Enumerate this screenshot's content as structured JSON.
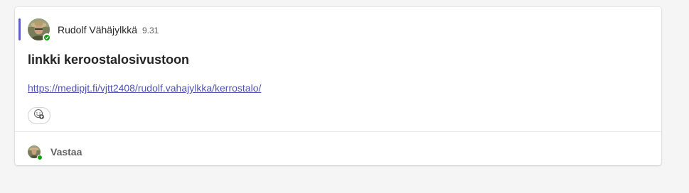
{
  "message": {
    "author": "Rudolf Vähäjylkkä",
    "timestamp": "9.31",
    "subject": "linkki keroostalosivustoon",
    "link": "https://medipjt.fi/vjtt2408/rudolf.vahajylkka/kerrostalo/",
    "reaction_icon": "add-reaction-icon",
    "presence": "available",
    "accent_color": "#5b5fc7",
    "link_color": "#4f52b2",
    "presence_color": "#13a10e"
  },
  "reply": {
    "label": "Vastaa"
  }
}
